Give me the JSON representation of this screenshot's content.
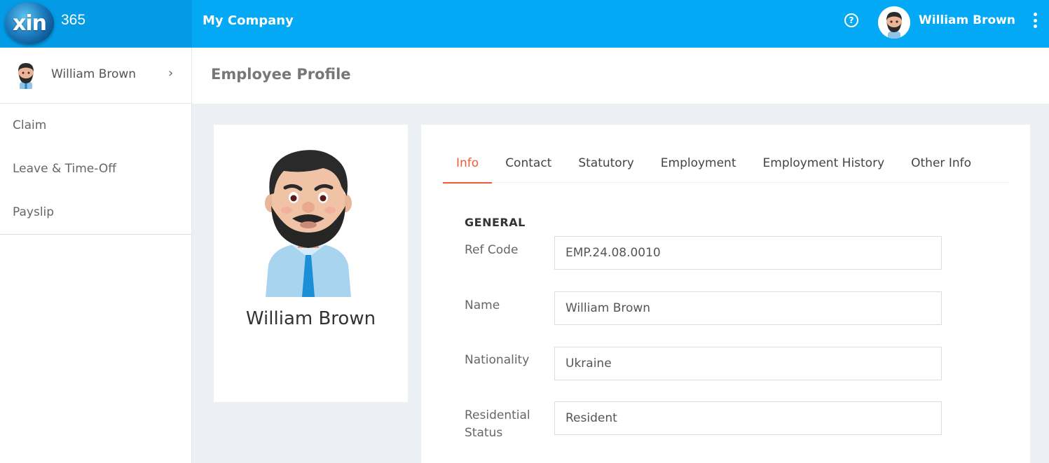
{
  "topbar": {
    "logo_text": "xin",
    "brand_suffix": "365",
    "company": "My Company",
    "user_name": "William Brown"
  },
  "sidebar": {
    "user_name": "William Brown",
    "items": [
      {
        "label": "Claim"
      },
      {
        "label": "Leave & Time-Off"
      },
      {
        "label": "Payslip"
      }
    ]
  },
  "page": {
    "title": "Employee Profile"
  },
  "profile": {
    "name": "William Brown"
  },
  "tabs": [
    {
      "label": "Info",
      "active": true
    },
    {
      "label": "Contact"
    },
    {
      "label": "Statutory"
    },
    {
      "label": "Employment"
    },
    {
      "label": "Employment History"
    },
    {
      "label": "Other Info"
    }
  ],
  "general": {
    "section_title": "GENERAL",
    "fields": [
      {
        "label": "Ref Code",
        "value": "EMP.24.08.0010"
      },
      {
        "label": "Name",
        "value": "William Brown"
      },
      {
        "label": "Nationality",
        "value": "Ukraine"
      },
      {
        "label": "Residential Status",
        "value": "Resident"
      }
    ]
  },
  "colors": {
    "topbar": "#03a9f4",
    "accent": "#f05a3c",
    "background": "#eceff3"
  }
}
